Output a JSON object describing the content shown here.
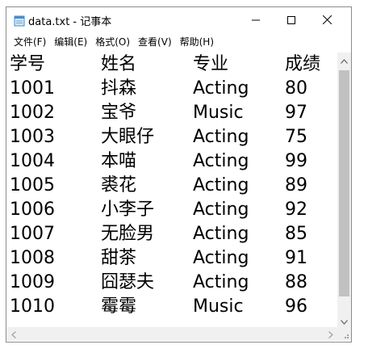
{
  "window": {
    "title": "data.txt - 记事本"
  },
  "menu": [
    "文件(F)",
    "编辑(E)",
    "格式(O)",
    "查看(V)",
    "帮助(H)"
  ],
  "content": {
    "header": [
      "学号",
      "姓名",
      "专业",
      "成绩"
    ],
    "rows": [
      [
        "1001",
        "抖森",
        "Acting",
        "80"
      ],
      [
        "1002",
        "宝爷",
        "Music",
        "97"
      ],
      [
        "1003",
        "大眼仔",
        "Acting",
        "75"
      ],
      [
        "1004",
        "本喵",
        "Acting",
        "99"
      ],
      [
        "1005",
        "裘花",
        "Acting",
        "89"
      ],
      [
        "1006",
        "小李子",
        "Acting",
        "92"
      ],
      [
        "1007",
        "无脸男",
        "Acting",
        "85"
      ],
      [
        "1008",
        "甜茶",
        "Acting",
        "91"
      ],
      [
        "1009",
        "囧瑟夫",
        "Acting",
        "88"
      ],
      [
        "1010",
        "霉霉",
        "Music",
        "96"
      ]
    ]
  },
  "icons": {
    "app": "notepad-icon",
    "minimize": "minimize-icon",
    "maximize": "maximize-icon",
    "close": "close-icon"
  },
  "colors": {
    "scroll_track": "#f0f0f0",
    "scroll_thumb": "#c1c1c1",
    "window_border": "#8c8c8c"
  }
}
